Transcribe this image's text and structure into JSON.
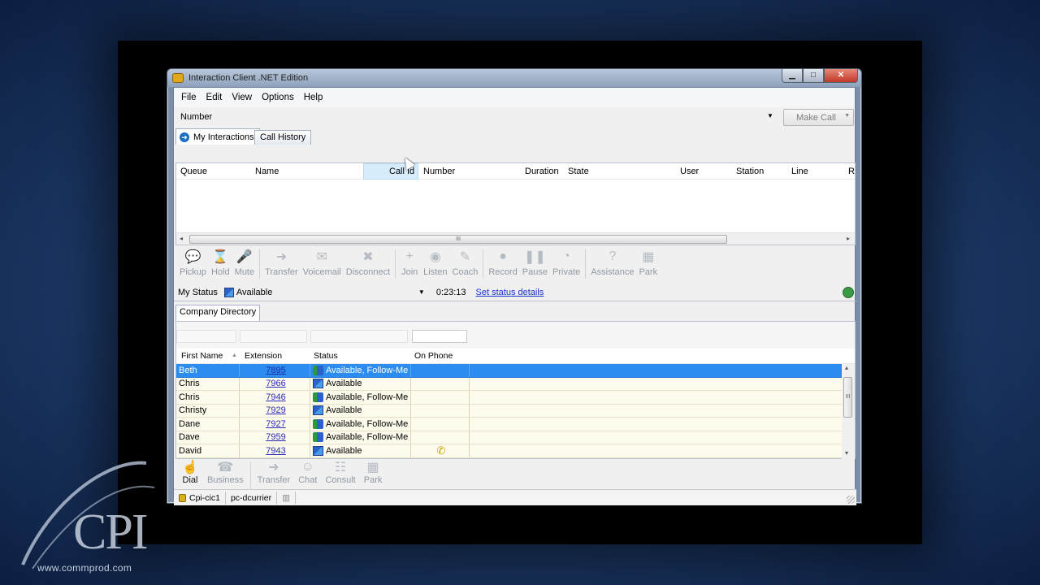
{
  "window": {
    "title": "Interaction Client .NET Edition",
    "controls": {
      "minimize": "▁",
      "maximize": "□",
      "close": "✕"
    }
  },
  "menu": [
    "File",
    "Edit",
    "View",
    "Options",
    "Help"
  ],
  "number_bar": {
    "label": "Number",
    "value": "",
    "make_call": "Make Call"
  },
  "tabs": {
    "my_interactions": "My Interactions",
    "call_history": "Call History"
  },
  "interactions_grid": {
    "columns": [
      "Queue",
      "Name",
      "Call Id",
      "Number",
      "Duration",
      "State",
      "User",
      "Station",
      "Line",
      "R"
    ],
    "scroll_grip": "III"
  },
  "call_toolbar": [
    {
      "label": "Pickup",
      "icon": "pickup-icon",
      "glyph": "💬"
    },
    {
      "label": "Hold",
      "icon": "hourglass-icon",
      "glyph": "⌛"
    },
    {
      "label": "Mute",
      "icon": "microphone-icon",
      "glyph": "🎤"
    },
    {
      "label": "Transfer",
      "icon": "transfer-icon",
      "glyph": "➜"
    },
    {
      "label": "Voicemail",
      "icon": "voicemail-icon",
      "glyph": "✉"
    },
    {
      "label": "Disconnect",
      "icon": "disconnect-icon",
      "glyph": "✖"
    },
    {
      "label": "Join",
      "icon": "join-icon",
      "glyph": "+"
    },
    {
      "label": "Listen",
      "icon": "listen-icon",
      "glyph": "◉"
    },
    {
      "label": "Coach",
      "icon": "coach-icon",
      "glyph": "✎"
    },
    {
      "label": "Record",
      "icon": "record-icon",
      "glyph": "●"
    },
    {
      "label": "Pause",
      "icon": "pause-icon",
      "glyph": "❚❚"
    },
    {
      "label": "Private",
      "icon": "private-icon",
      "glyph": "◔"
    },
    {
      "label": "Assistance",
      "icon": "help-icon",
      "glyph": "?"
    },
    {
      "label": "Park",
      "icon": "park-icon",
      "glyph": "▦"
    }
  ],
  "my_status": {
    "label": "My Status",
    "value": "Available",
    "timer": "0:23:13",
    "link": "Set status details"
  },
  "directory": {
    "tab": "Company Directory",
    "columns": [
      "First Name",
      "Extension",
      "Status",
      "On Phone"
    ],
    "rows": [
      {
        "first": "Beth",
        "ext": "7895",
        "status": "Available, Follow-Me",
        "icon": "follow-me-icon",
        "on_phone": "",
        "selected": true
      },
      {
        "first": "Chris",
        "ext": "7966",
        "status": "Available",
        "icon": "available-icon",
        "on_phone": "",
        "selected": false
      },
      {
        "first": "Chris",
        "ext": "7946",
        "status": "Available, Follow-Me",
        "icon": "follow-me-icon",
        "on_phone": "",
        "selected": false
      },
      {
        "first": "Christy",
        "ext": "7929",
        "status": "Available",
        "icon": "available-icon",
        "on_phone": "",
        "selected": false
      },
      {
        "first": "Dane",
        "ext": "7927",
        "status": "Available, Follow-Me",
        "icon": "follow-me-icon",
        "on_phone": "",
        "selected": false
      },
      {
        "first": "Dave",
        "ext": "7959",
        "status": "Available, Follow-Me",
        "icon": "follow-me-icon",
        "on_phone": "",
        "selected": false
      },
      {
        "first": "David",
        "ext": "7943",
        "status": "Available",
        "icon": "available-icon",
        "on_phone": "✆",
        "selected": false
      }
    ]
  },
  "dir_toolbar": [
    {
      "label": "Dial",
      "icon": "dial-hand-icon",
      "glyph": "☝",
      "active": true
    },
    {
      "label": "Business",
      "icon": "business-icon",
      "glyph": "☎",
      "active": false
    },
    {
      "label": "Transfer",
      "icon": "transfer-icon",
      "glyph": "➜",
      "active": false
    },
    {
      "label": "Chat",
      "icon": "chat-icon",
      "glyph": "☺",
      "active": false
    },
    {
      "label": "Consult",
      "icon": "consult-icon",
      "glyph": "☷",
      "active": false
    },
    {
      "label": "Park",
      "icon": "park-icon",
      "glyph": "▦",
      "active": false
    }
  ],
  "statusbar": {
    "server": "Cpi-cic1",
    "station": "pc-dcurrier"
  },
  "branding": {
    "logo": "CPI",
    "url": "www.commprod.com"
  }
}
